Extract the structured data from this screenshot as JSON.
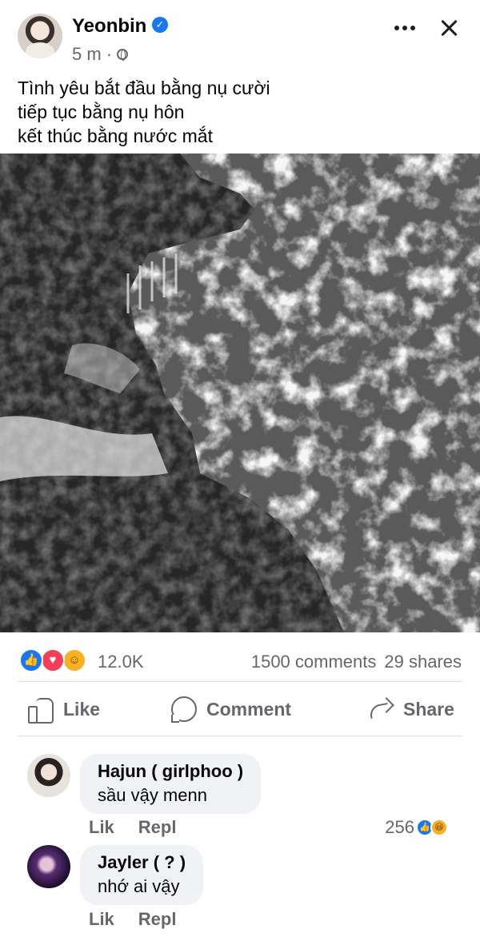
{
  "post": {
    "author": "Yeonbin",
    "verified_icon": "verified-badge-icon",
    "time": "5 m",
    "time_separator": "·",
    "privacy_icon": "globe-icon",
    "caption_lines": [
      "Tình yêu bắt đầu bằng nụ cười",
      "tiếp tục bằng nụ hôn",
      "kết thúc bằng nước mắt"
    ],
    "photo": "black-and-white sea waves crashing on dark rocks"
  },
  "reactions": {
    "icons": [
      "like-reaction-icon",
      "love-reaction-icon",
      "care-reaction-icon"
    ],
    "count": "12.0K",
    "comments": "1500 comments",
    "shares": "29 shares"
  },
  "actions": {
    "like": "Like",
    "comment": "Comment",
    "share": "Share"
  },
  "comments": [
    {
      "name": "Hajun ( girlphoo )",
      "text": "sầu vậy menn",
      "like_label": "Lik",
      "reply_label": "Repl",
      "reaction_count": "256",
      "reaction_icons": [
        "like-reaction-icon",
        "haha-reaction-icon"
      ]
    },
    {
      "name": "Jayler ( ? )",
      "text": "nhớ ai vậy",
      "like_label": "Lik",
      "reply_label": "Repl"
    }
  ],
  "colors": {
    "accent": "#1877f2",
    "secondary_text": "#65676b",
    "comment_bubble": "#f0f2f5"
  }
}
